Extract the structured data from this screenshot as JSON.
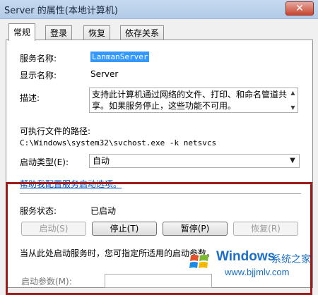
{
  "window": {
    "title": "Server 的属性(本地计算机)",
    "close_label": "✕"
  },
  "tabs": [
    {
      "label": "常规",
      "active": true
    },
    {
      "label": "登录",
      "active": false
    },
    {
      "label": "恢复",
      "active": false
    },
    {
      "label": "依存关系",
      "active": false
    }
  ],
  "general": {
    "service_name_label": "服务名称:",
    "service_name_value": "LanmanServer",
    "display_name_label": "显示名称:",
    "display_name_value": "Server",
    "description_label": "描述:",
    "description_value": "支持此计算机通过网络的文件、打印、和命名管道共享。如果服务停止，这些功能不可用。",
    "exec_path_label": "可执行文件的路径:",
    "exec_path_value": "C:\\Windows\\system32\\svchost.exe -k netsvcs",
    "startup_type_label": "启动类型(E):",
    "startup_type_value": "自动",
    "help_link": "帮助我配置服务启动选项。",
    "service_status_label": "服务状态:",
    "service_status_value": "已启动",
    "start_hint": "当从此处启动服务时，您可指定所适用的启动参数。",
    "start_params_label": "启动参数(M):"
  },
  "buttons": {
    "start": {
      "label": "启动(S)",
      "enabled": false
    },
    "stop": {
      "label": "停止(T)",
      "enabled": true
    },
    "pause": {
      "label": "暂停(P)",
      "enabled": true
    },
    "resume": {
      "label": "恢复(R)",
      "enabled": false
    }
  },
  "watermark": {
    "title": "Windows",
    "subtitle": "系统之家",
    "url": "www.bjjmlv.com"
  },
  "colors": {
    "highlight_frame": "#9c1c1c",
    "selection": "#3399ff",
    "link": "#0055cc"
  }
}
